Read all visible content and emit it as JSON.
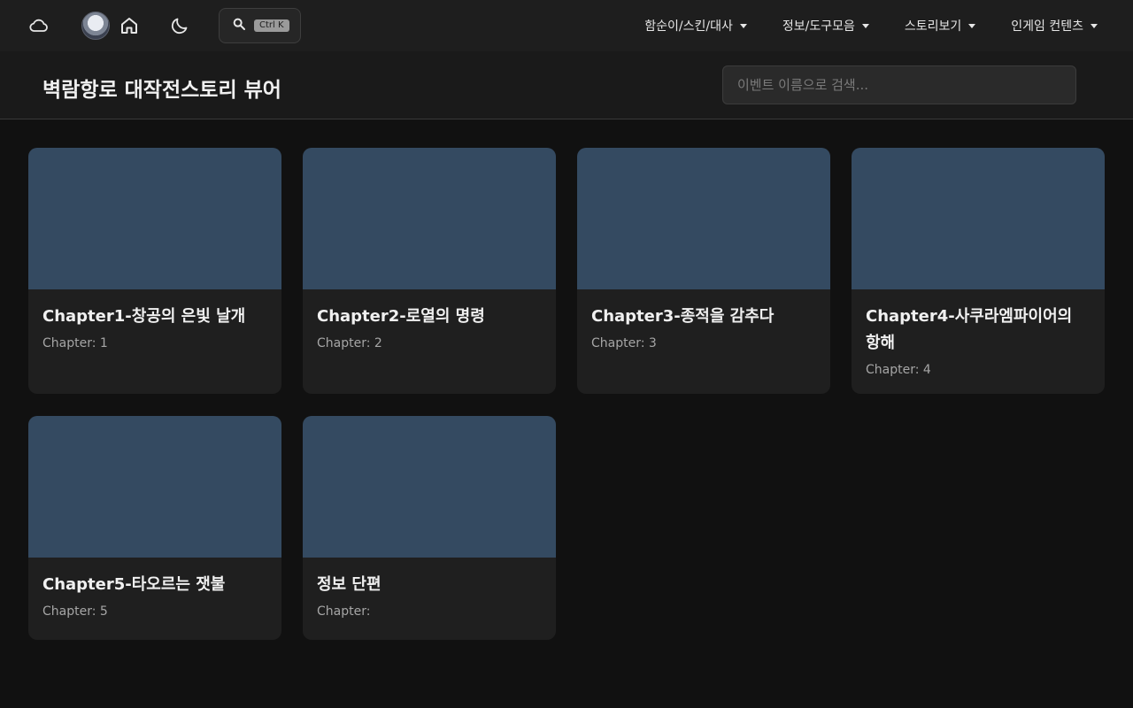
{
  "navbar": {
    "icons": [
      "cloud-icon",
      "home-icon",
      "moon-icon",
      "search-icon"
    ],
    "search_shortcut": "Ctrl K",
    "menu": [
      {
        "label": "함순이/스킨/대사"
      },
      {
        "label": "정보/도구모음"
      },
      {
        "label": "스토리보기"
      },
      {
        "label": "인게임 컨텐츠"
      }
    ]
  },
  "header": {
    "title": "벽람항로 대작전스토리 뷰어",
    "search_placeholder": "이벤트 이름으로 검색..."
  },
  "cards": [
    {
      "title": "Chapter1-창공의 은빛 날개",
      "meta": "Chapter: 1"
    },
    {
      "title": "Chapter2-로열의 명령",
      "meta": "Chapter: 2"
    },
    {
      "title": "Chapter3-종적을 감추다",
      "meta": "Chapter: 3"
    },
    {
      "title": "Chapter4-사쿠라엠파이어의 항해",
      "meta": "Chapter: 4"
    },
    {
      "title": "Chapter5-타오르는 잿불",
      "meta": "Chapter: 5"
    },
    {
      "title": "정보 단편",
      "meta": "Chapter: "
    }
  ],
  "colors": {
    "background": "#111111",
    "navbar": "#1e1e1e",
    "card": "#1f1f1f",
    "thumbnail": "#344a61"
  }
}
